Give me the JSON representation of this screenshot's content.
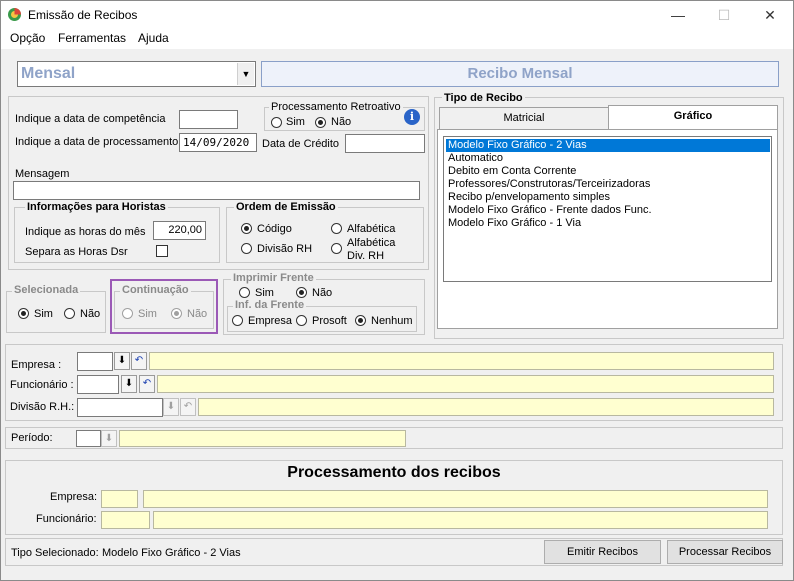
{
  "window": {
    "title": "Emissão de Recibos",
    "minimize": "—",
    "maximize": "☐",
    "close": "✕"
  },
  "menu": {
    "items": [
      "Opção",
      "Ferramentas",
      "Ajuda"
    ]
  },
  "header": {
    "combo_value": "Mensal",
    "banner": "Recibo Mensal"
  },
  "dates": {
    "competencia_label": "Indique a data de competência",
    "competencia_value": "",
    "processamento_label": "Indique a data de processamento",
    "processamento_value": "14/09/2020",
    "credito_label": "Data de Crédito",
    "credito_value": ""
  },
  "retroativo": {
    "title": "Processamento Retroativo",
    "sim": "Sim",
    "nao": "Não",
    "selected": "nao"
  },
  "mensagem": {
    "label": "Mensagem",
    "value": ""
  },
  "horistas": {
    "title": "Informações para Horistas",
    "horas_label": "Indique as horas do mês",
    "horas_value": "220,00",
    "separa_label": "Separa as Horas Dsr"
  },
  "ordem": {
    "title": "Ordem de Emissão",
    "codigo": "Código",
    "alfabetica": "Alfabética",
    "divisao": "Divisão RH",
    "alfabetica_div_1": "Alfabética",
    "alfabetica_div_2": "Div.  RH",
    "selected": "codigo"
  },
  "selecionada": {
    "title": "Selecionada",
    "sim": "Sim",
    "nao": "Não",
    "selected": "sim"
  },
  "continuacao": {
    "title": "Continuação",
    "sim": "Sim",
    "nao": "Não",
    "selected": "nao"
  },
  "imprimir_frente": {
    "title": "Imprimir Frente",
    "sim": "Sim",
    "nao": "Não",
    "selected": "nao"
  },
  "inf_frente": {
    "title": "Inf. da Frente",
    "empresa": "Empresa",
    "prosoft": "Prosoft",
    "nenhum": "Nenhum",
    "selected": "nenhum"
  },
  "tipo_recibo": {
    "title": "Tipo de Recibo",
    "tabs": [
      "Matricial",
      "Gráfico"
    ],
    "active_tab": "Gráfico",
    "items": [
      "Modelo Fixo Gráfico - 2 Vias",
      "Automatico",
      "Debito em Conta Corrente",
      "Professores/Construtoras/Terceirizadoras",
      "Recibo p/envelopamento simples",
      "Modelo Fixo Gráfico - Frente dados Func.",
      "Modelo Fixo Gráfico - 1 Via"
    ],
    "selected_index": 0
  },
  "filtros": {
    "empresa_label": "Empresa :",
    "funcionario_label": "Funcionário :",
    "divisao_label": "Divisão R.H.:",
    "periodo_label": "Período:"
  },
  "processamento": {
    "title": "Processamento dos recibos",
    "empresa_label": "Empresa:",
    "funcionario_label": "Funcionário:"
  },
  "status": {
    "tipo_label": "Tipo Selecionado:",
    "tipo_value": "Modelo Fixo Gráfico - 2 Vias",
    "emitir": "Emitir Recibos",
    "processar": "Processar Recibos"
  }
}
